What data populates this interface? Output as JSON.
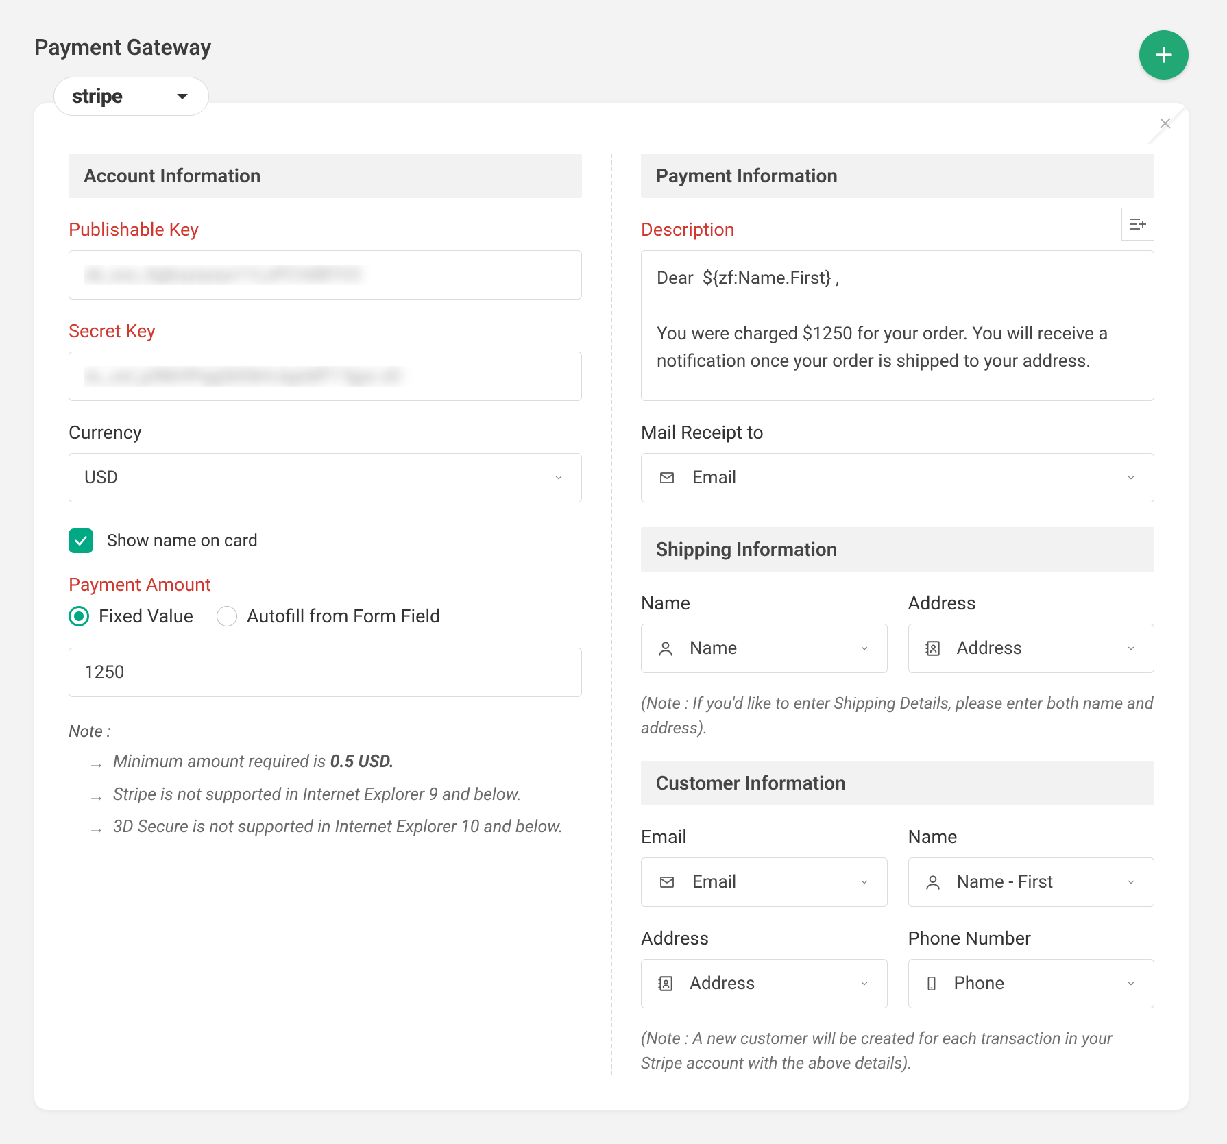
{
  "page_title": "Payment Gateway",
  "gateway": {
    "selected": "stripe"
  },
  "account": {
    "section_title": "Account Information",
    "publishable_key_label": "Publishable Key",
    "publishable_key_value": "sk_xxx_Xgkxyxyxyx11LzPCVd8YV3",
    "secret_key_label": "Secret Key",
    "secret_key_value": "sL_xxl_jzNkHPqgQtObHJqytdP7 fgyx xD",
    "currency_label": "Currency",
    "currency_value": "USD",
    "show_name_on_card_label": "Show name on card",
    "payment_amount_label": "Payment Amount",
    "radio_fixed": "Fixed Value",
    "radio_autofill": "Autofill from Form Field",
    "amount_value": "1250",
    "note_title": "Note :",
    "note1_prefix": "Minimum amount required is ",
    "note1_bold": "0.5 USD.",
    "note2": "Stripe is not supported in Internet Explorer 9 and below.",
    "note3": "3D Secure is not supported in Internet Explorer 10 and below."
  },
  "payment": {
    "section_title": "Payment Information",
    "description_label": "Description",
    "description_value": "Dear  ${zf:Name.First} ,\n\nYou were charged $1250 for your order. You will receive a notification once your order is shipped to your address.",
    "mail_receipt_label": "Mail Receipt to",
    "mail_receipt_value": "Email"
  },
  "shipping": {
    "section_title": "Shipping Information",
    "name_label": "Name",
    "name_value": "Name",
    "address_label": "Address",
    "address_value": "Address",
    "note": "(Note : If you'd like to enter Shipping Details, please enter both name and address)."
  },
  "customer": {
    "section_title": "Customer Information",
    "email_label": "Email",
    "email_value": "Email",
    "name_label": "Name",
    "name_value": "Name - First",
    "address_label": "Address",
    "address_value": "Address",
    "phone_label": "Phone Number",
    "phone_value": "Phone",
    "note": "(Note : A new customer will be created for each transaction in your Stripe account with the above details)."
  }
}
